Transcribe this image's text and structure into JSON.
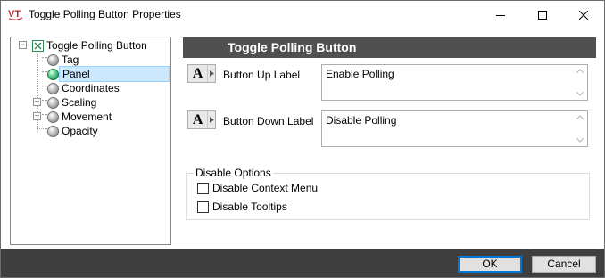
{
  "window": {
    "logo_text": "VT",
    "title": "Toggle Polling Button Properties"
  },
  "tree": {
    "root": {
      "label": "Toggle Polling Button",
      "expanded": true
    },
    "items": [
      {
        "label": "Tag",
        "selected": false,
        "expandable": false
      },
      {
        "label": "Panel",
        "selected": true,
        "expandable": false
      },
      {
        "label": "Coordinates",
        "selected": false,
        "expandable": false
      },
      {
        "label": "Scaling",
        "selected": false,
        "expandable": true
      },
      {
        "label": "Movement",
        "selected": false,
        "expandable": true
      },
      {
        "label": "Opacity",
        "selected": false,
        "expandable": false
      }
    ]
  },
  "panel": {
    "header": "Toggle Polling Button",
    "font_button_glyph": "A",
    "fields": [
      {
        "label": "Button Up Label",
        "value": "Enable Polling"
      },
      {
        "label": "Button Down Label",
        "value": "Disable Polling"
      }
    ],
    "disable_options": {
      "title": "Disable Options",
      "checkboxes": [
        {
          "label": "Disable Context Menu",
          "checked": false
        },
        {
          "label": "Disable Tooltips",
          "checked": false
        }
      ]
    }
  },
  "footer": {
    "ok_label": "OK",
    "cancel_label": "Cancel"
  },
  "colors": {
    "header_bg": "#505050",
    "footer_bg": "#3f3f3f",
    "selection_bg": "#cce8ff",
    "logo_red": "#c0272d",
    "ok_focus": "#0078d7"
  }
}
